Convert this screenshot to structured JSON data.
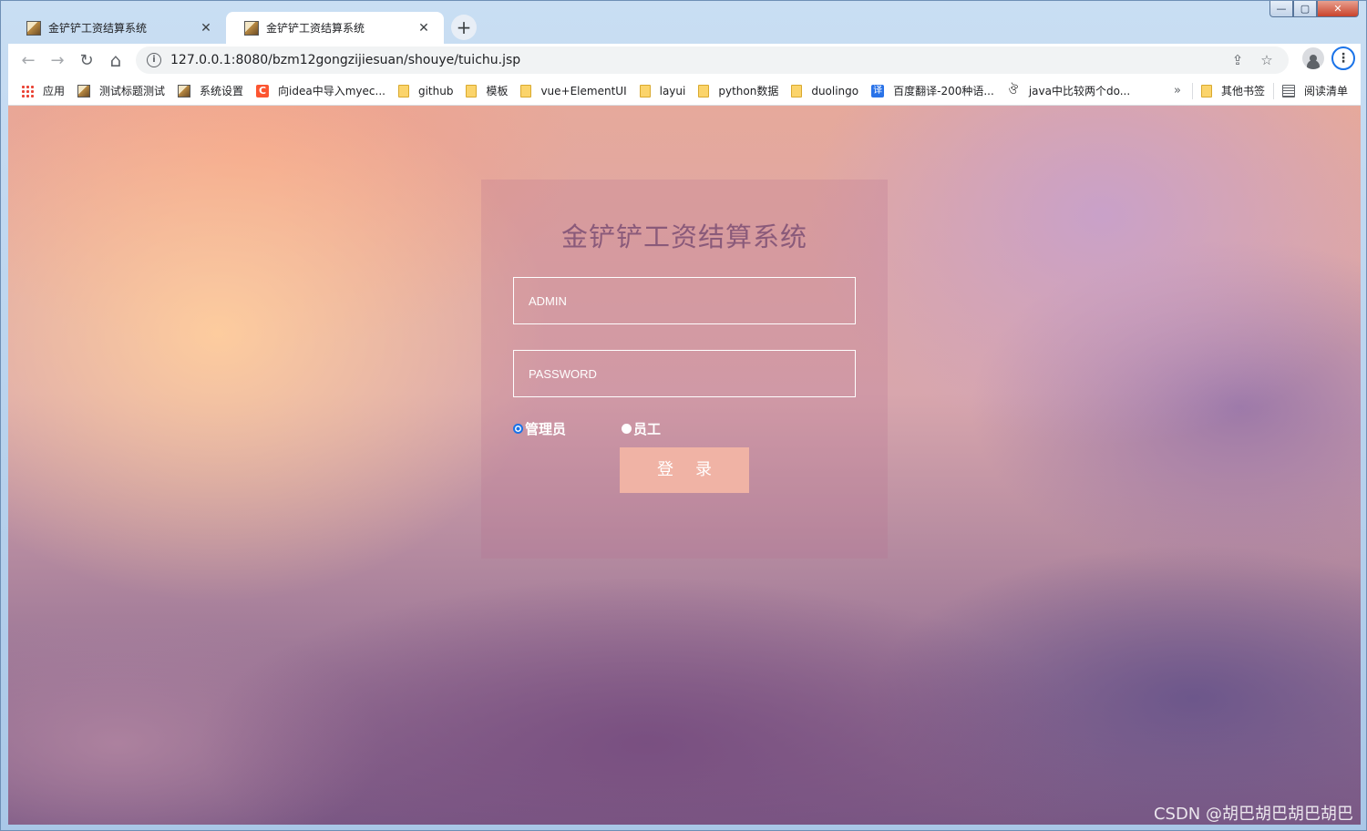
{
  "window": {
    "controls": {
      "minimize": "—",
      "maximize": "▢",
      "close": "✕"
    }
  },
  "tabs": [
    {
      "title": "金铲铲工资结算系统",
      "active": false
    },
    {
      "title": "金铲铲工资结算系统",
      "active": true
    }
  ],
  "new_tab_label": "+",
  "toolbar": {
    "back_icon": "←",
    "forward_icon": "→",
    "reload_icon": "↻",
    "home_icon": "⌂",
    "info_icon": "i",
    "url": "127.0.0.1:8080/bzm12gongzijiesuan/shouye/tuichu.jsp",
    "share_icon": "⇪",
    "star_icon": "☆",
    "menu_icon": "⋮"
  },
  "bookmarks": [
    {
      "label": "应用",
      "icon": "apps-icon"
    },
    {
      "label": "测试标题测试",
      "icon": "image-icon"
    },
    {
      "label": "系统设置",
      "icon": "image-icon"
    },
    {
      "label": "向idea中导入myec...",
      "icon": "csdn-icon",
      "glyph": "C"
    },
    {
      "label": "github",
      "icon": "folder-icon"
    },
    {
      "label": "模板",
      "icon": "folder-icon"
    },
    {
      "label": "vue+ElementUI",
      "icon": "folder-icon"
    },
    {
      "label": "layui",
      "icon": "folder-icon"
    },
    {
      "label": "python数据",
      "icon": "folder-icon"
    },
    {
      "label": "duolingo",
      "icon": "folder-icon"
    },
    {
      "label": "百度翻译-200种语...",
      "icon": "translate-icon",
      "glyph": "译"
    },
    {
      "label": "java中比较两个do...",
      "icon": "leaf-icon",
      "glyph": "ঔ"
    }
  ],
  "bookmarks_more": "»",
  "bookmarks_other": "其他书签",
  "reading_list": "阅读清单",
  "login": {
    "title": "金铲铲工资结算系统",
    "username_placeholder": "ADMIN",
    "password_placeholder": "PASSWORD",
    "role_admin": "管理员",
    "role_staff": "员工",
    "submit": "登录"
  },
  "watermark": "CSDN @胡巴胡巴胡巴胡巴",
  "colors": {
    "accent": "#1a73e8",
    "button": "#f0b3a5",
    "title": "#8a5a7a"
  }
}
